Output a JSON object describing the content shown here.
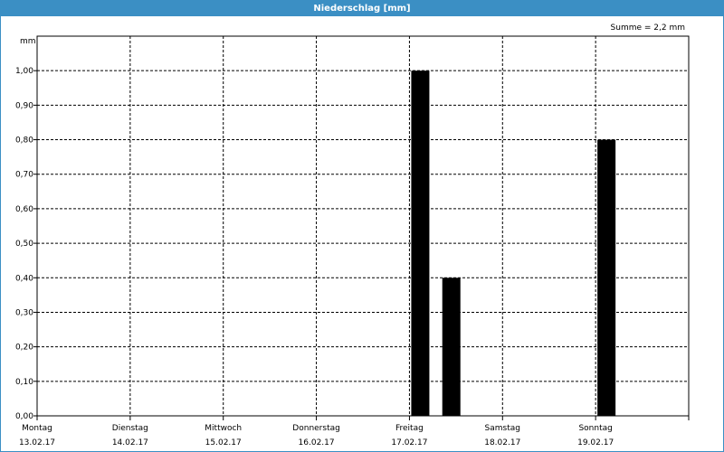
{
  "window": {
    "title": "Niederschlag [mm]"
  },
  "summary": "Summe = 2,2 mm",
  "colors": {
    "title_bar": "#3b8fc4",
    "bars": "#000000",
    "grid": "#000000"
  },
  "chart_data": {
    "type": "bar",
    "title": "Niederschlag [mm]",
    "ylabel": "mm",
    "ylim": [
      0,
      1.1
    ],
    "yticks": [
      "0,00",
      "0,10",
      "0,20",
      "0,30",
      "0,40",
      "0,50",
      "0,60",
      "0,70",
      "0,80",
      "0,90",
      "1,00"
    ],
    "days": [
      {
        "name": "Montag",
        "date": "13.02.17"
      },
      {
        "name": "Dienstag",
        "date": "14.02.17"
      },
      {
        "name": "Mittwoch",
        "date": "15.02.17"
      },
      {
        "name": "Donnerstag",
        "date": "16.02.17"
      },
      {
        "name": "Freitag",
        "date": "17.02.17"
      },
      {
        "name": "Samstag",
        "date": "18.02.17"
      },
      {
        "name": "Sonntag",
        "date": "19.02.17"
      }
    ],
    "bars": [
      {
        "time": "17.02.17 00:00",
        "value": 1.0
      },
      {
        "time": "17.02.17 08:00",
        "value": 0.4
      },
      {
        "time": "19.02.17 00:00",
        "value": 0.8
      }
    ],
    "grid": true
  }
}
